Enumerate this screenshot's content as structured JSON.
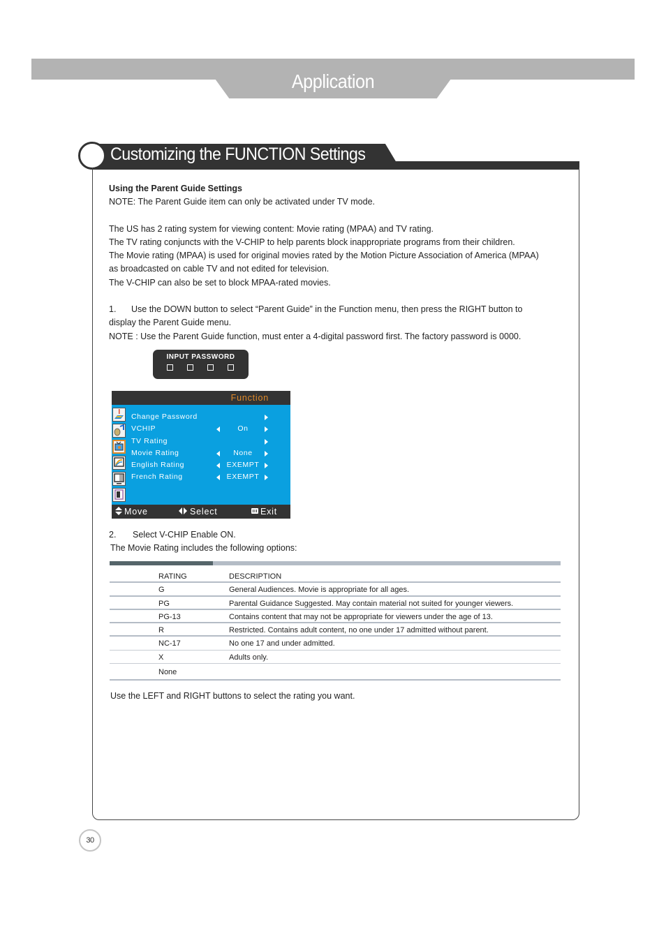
{
  "header": {
    "title": "Application"
  },
  "section": {
    "title": "Customizing the FUNCTION Settings"
  },
  "content": {
    "subheading": "Using the Parent Guide Settings",
    "note1": "NOTE: The Parent Guide item can only be activated under TV mode.",
    "para": [
      "The US has 2 rating system for viewing content: Movie rating (MPAA) and TV rating.",
      "The TV rating conjuncts with the V-CHIP to help parents block inappropriate programs from their children.",
      "The Movie rating (MPAA) is used for original movies rated by the Motion Picture Association of America (MPAA)",
      "as broadcasted on cable TV and not edited for television.",
      "The V-CHIP can also be set to block MPAA-rated movies."
    ],
    "step1_num": "1.",
    "step1_line1": "Use the DOWN button to select “Parent Guide” in the Function menu, then press the RIGHT button to",
    "step1_line2": "display the Parent Guide menu.",
    "note2": "NOTE : Use the Parent Guide function, must enter a 4-digital password first. The factory password is 0000.",
    "step2_num": "2.",
    "step2": "Select V-CHIP Enable ON.",
    "movie_intro": "The Movie Rating includes the following options:",
    "footer_text": "Use the LEFT and RIGHT buttons to select the rating you want."
  },
  "password_dialog": {
    "label": "INPUT PASSWORD",
    "digits": 4
  },
  "osd_menu": {
    "title": "Function",
    "title_color": "#e08a2a",
    "bg_color": "#0aa0e0",
    "icons": [
      "picture-icon",
      "sound-icon",
      "function-icon",
      "display-icon",
      "screen-icon",
      "exit-menu-icon"
    ],
    "active_icon": 2,
    "rows": [
      {
        "label": "Change Password",
        "value": "",
        "left_arrow": false,
        "right_arrow": true
      },
      {
        "label": "VCHIP",
        "value": "On",
        "left_arrow": true,
        "right_arrow": true
      },
      {
        "label": "TV Rating",
        "value": "",
        "left_arrow": false,
        "right_arrow": true
      },
      {
        "label": "Movie Rating",
        "value": "None",
        "left_arrow": true,
        "right_arrow": true
      },
      {
        "label": "English Rating",
        "value": "EXEMPT",
        "left_arrow": true,
        "right_arrow": true
      },
      {
        "label": "French Rating",
        "value": "EXEMPT",
        "left_arrow": true,
        "right_arrow": true
      }
    ],
    "footer": {
      "move": "Move",
      "select": "Select",
      "exit": "Exit"
    }
  },
  "rating_table": {
    "headers": [
      "RATING",
      "DESCRIPTION"
    ],
    "rows": [
      [
        "G",
        "General Audiences. Movie is appropriate for all ages."
      ],
      [
        "PG",
        "Parental Guidance Suggested. May contain material not suited for younger viewers."
      ],
      [
        "PG-13",
        "Contains content that may not be appropriate for viewers under the age of 13."
      ],
      [
        "R",
        "Restricted. Contains adult content, no one under 17 admitted without parent."
      ],
      [
        "NC-17",
        "No one 17 and under admitted."
      ],
      [
        "X",
        "Adults only."
      ],
      [
        "None",
        ""
      ]
    ]
  },
  "page_number": "30"
}
